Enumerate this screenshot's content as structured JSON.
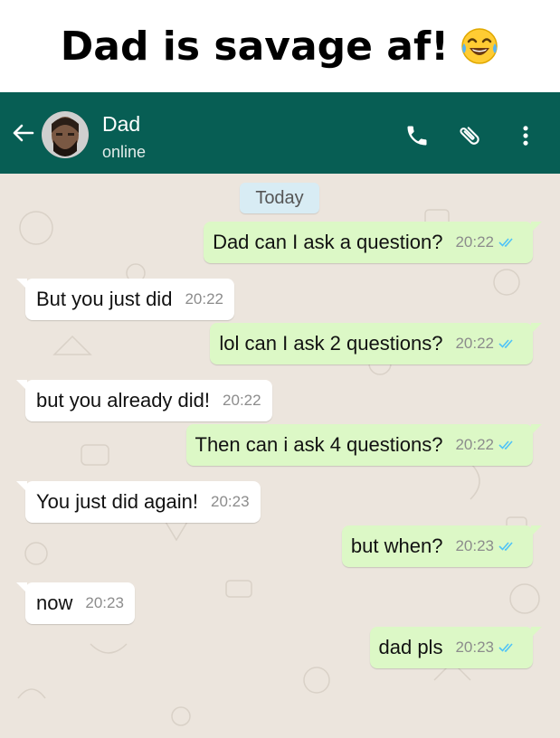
{
  "caption": {
    "text": "Dad is savage af!",
    "emoji": "tears-of-joy-emoji"
  },
  "header": {
    "contact_name": "Dad",
    "status": "online",
    "icons": [
      "back-arrow-icon",
      "phone-icon",
      "paperclip-icon",
      "more-vert-icon"
    ]
  },
  "colors": {
    "header_bg": "#075E54",
    "chat_bg": "#ECE5DD",
    "outgoing_bubble": "#DCF8C6",
    "incoming_bubble": "#FFFFFF",
    "read_ticks": "#4FC3F7"
  },
  "date_label": "Today",
  "messages": [
    {
      "dir": "out",
      "text": "Dad can I ask a question?",
      "time": "20:22"
    },
    {
      "dir": "in",
      "text": "But you just did",
      "time": "20:22"
    },
    {
      "dir": "out",
      "text": "lol can I ask 2 questions?",
      "time": "20:22"
    },
    {
      "dir": "in",
      "text": "but you already did!",
      "time": "20:22"
    },
    {
      "dir": "out",
      "text": "Then can i ask 4 questions?",
      "time": "20:22"
    },
    {
      "dir": "in",
      "text": "You just did again!",
      "time": "20:23"
    },
    {
      "dir": "out",
      "text": "but when?",
      "time": "20:23"
    },
    {
      "dir": "in",
      "text": "now",
      "time": "20:23"
    },
    {
      "dir": "out",
      "text": "dad pls",
      "time": "20:23"
    }
  ]
}
